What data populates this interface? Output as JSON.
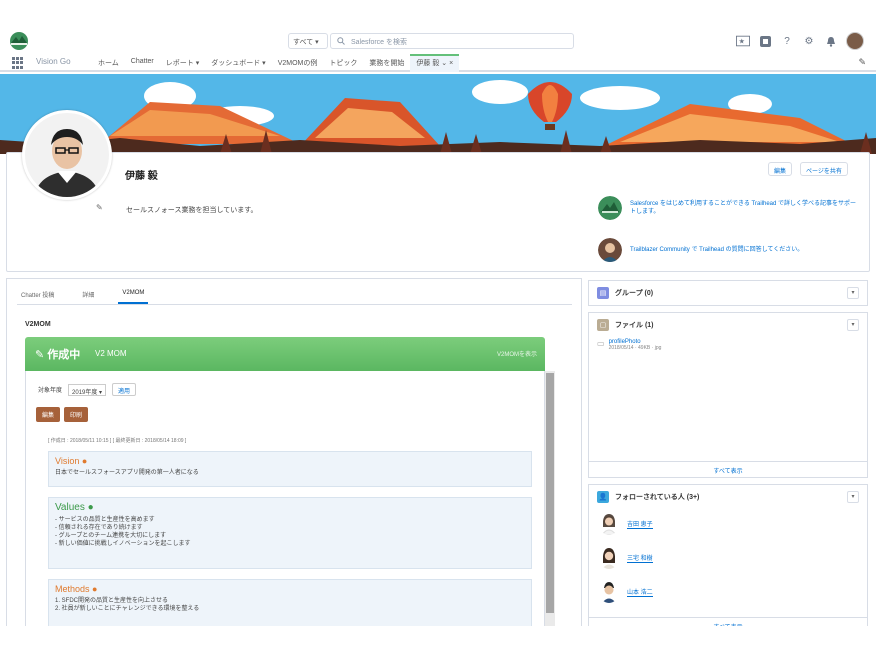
{
  "header": {
    "search_scope": "すべて ▾",
    "search_placeholder": "Salesforce を検索",
    "icons": [
      "favorites-icon",
      "setup-assistant-icon",
      "help-icon",
      "gear-icon",
      "notifications-icon",
      "user-avatar"
    ]
  },
  "nav": {
    "app_name": "Vision Go",
    "items": [
      "ホーム",
      "Chatter",
      "レポート ▾",
      "ダッシュボード ▾",
      "V2MOMの例",
      "トピック",
      "業務を開始",
      "伊藤 毅 ⌄ ×"
    ]
  },
  "profile": {
    "name": "伊藤 毅",
    "description": "セールスノォース業務を担当しています。",
    "buttons": [
      "編集",
      "ページを共有"
    ],
    "tips": [
      "Salesforce をはじめて利用することができる Trailhead で詳しく学べる記事をサポートします。",
      "Trailblazer Community で Trailhead の質問に回答してください。"
    ]
  },
  "main": {
    "tabs": [
      "Chatter 投稿",
      "詳細",
      "V2MOM"
    ],
    "section_title": "V2MOM",
    "v2mom": {
      "status": "作成中",
      "name": "V2 MOM",
      "right_label": "V2MOMを表示",
      "period_label": "対象年度",
      "period_value": "2019年度 ▾",
      "apply_button": "適用",
      "buttons": [
        "編集",
        "印刷"
      ],
      "meta": "[ 作成日 : 2018/05/11 10:15 ] [ 最終更新日 : 2018/05/14 18:09 ]",
      "vision_title": "Vision",
      "vision_text": "日本でセールスフォースアプリ開発の第一人者になる",
      "values_title": "Values",
      "values": [
        "- サービスの品質と生産性を高めます",
        "- 信頼される存在であり続けます",
        "- グループとのチーム連携を大切にします",
        "- 新しい価値に挑戦しイノベーションを起こします"
      ],
      "methods_title": "Methods",
      "methods": [
        "1. SFDC開発の品質と生産性を向上させる",
        "2. 社員が新しいことにチャレンジできる環境を整える"
      ]
    }
  },
  "sidebar": {
    "groups": {
      "title": "グループ (0)"
    },
    "files": {
      "title": "ファイル (1)",
      "file_name": "profilePhoto",
      "file_meta": "2018/05/14 · 49KB · jpg",
      "footer": "すべて表示"
    },
    "followers": {
      "title": "フォローされている人 (3+)",
      "people": [
        "吉田 恵子",
        "三宅 和樹",
        "山本 浩二"
      ],
      "footer": "すべて表示"
    }
  },
  "colors": {
    "brand_blue": "#0070d2",
    "v2mom_green": "#5bb761",
    "action_brown": "#a6613a",
    "banner_sky": "#53b7e8"
  }
}
